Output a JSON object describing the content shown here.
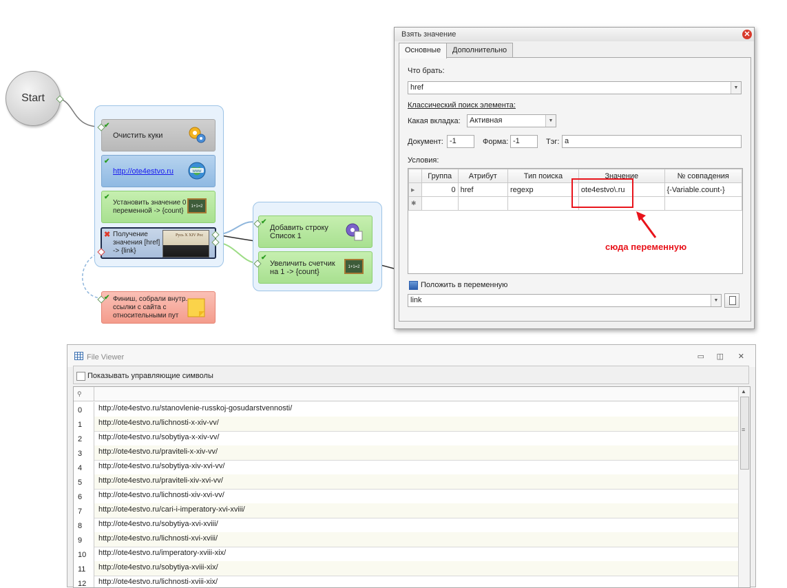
{
  "canvas": {
    "start_label": "Start",
    "blocks": {
      "clear_cookies": "Очистить куки",
      "url": "http://ote4estvo.ru",
      "set_value": "Установить значение 0 переменной -> {count}",
      "get_value": "Получение значения [href] -> {link}",
      "get_value_thumb": "Русь X XIV   Рос",
      "add_row": "Добавить строку Список 1",
      "increment": "Увеличить счетчик на 1 -> {count}",
      "finish": "Финиш, собрали внутр. ссылки с сайта с относительными пут"
    },
    "chalk_text": "1+1=2"
  },
  "dialog": {
    "title": "Взять значение",
    "tabs": [
      "Основные",
      "Дополнительно"
    ],
    "what_label": "Что брать:",
    "what_value": "href",
    "classic_search_label": "Классический поиск элемента:",
    "tab_label": "Какая вкладка:",
    "tab_value": "Активная",
    "document_label": "Документ:",
    "document_value": "-1",
    "form_label": "Форма:",
    "form_value": "-1",
    "tag_label": "Тэг:",
    "tag_value": "a",
    "conditions_label": "Условия:",
    "conditions_table": {
      "headers": [
        "Группа",
        "Атрибут",
        "Тип поиска",
        "Значение",
        "№ совпадения"
      ],
      "rows": [
        [
          "0",
          "href",
          "regexp",
          "ote4estvo\\.ru",
          "{-Variable.count-}"
        ]
      ]
    },
    "put_in_var_label": "Положить в переменную",
    "put_in_var_value": "link"
  },
  "annotation": "сюда переменную",
  "file_viewer": {
    "title": "File Viewer",
    "show_control_chars_label": "Показывать управляющие символы",
    "rows": [
      {
        "index": "0",
        "value": "http://ote4estvo.ru/stanovlenie-russkoj-gosudarstvennosti/"
      },
      {
        "index": "1",
        "value": "http://ote4estvo.ru/lichnosti-x-xiv-vv/"
      },
      {
        "index": "2",
        "value": "http://ote4estvo.ru/sobytiya-x-xiv-vv/"
      },
      {
        "index": "3",
        "value": "http://ote4estvo.ru/praviteli-x-xiv-vv/"
      },
      {
        "index": "4",
        "value": "http://ote4estvo.ru/sobytiya-xiv-xvi-vv/"
      },
      {
        "index": "5",
        "value": "http://ote4estvo.ru/praviteli-xiv-xvi-vv/"
      },
      {
        "index": "6",
        "value": "http://ote4estvo.ru/lichnosti-xiv-xvi-vv/"
      },
      {
        "index": "7",
        "value": "http://ote4estvo.ru/cari-i-imperatory-xvi-xviii/"
      },
      {
        "index": "8",
        "value": "http://ote4estvo.ru/sobytiya-xvi-xviii/"
      },
      {
        "index": "9",
        "value": "http://ote4estvo.ru/lichnosti-xvi-xviii/"
      },
      {
        "index": "10",
        "value": "http://ote4estvo.ru/imperatory-xviii-xix/"
      },
      {
        "index": "11",
        "value": "http://ote4estvo.ru/sobytiya-xviii-xix/"
      },
      {
        "index": "12",
        "value": "http://ote4estvo.ru/lichnosti-xviii-xix/"
      }
    ]
  }
}
